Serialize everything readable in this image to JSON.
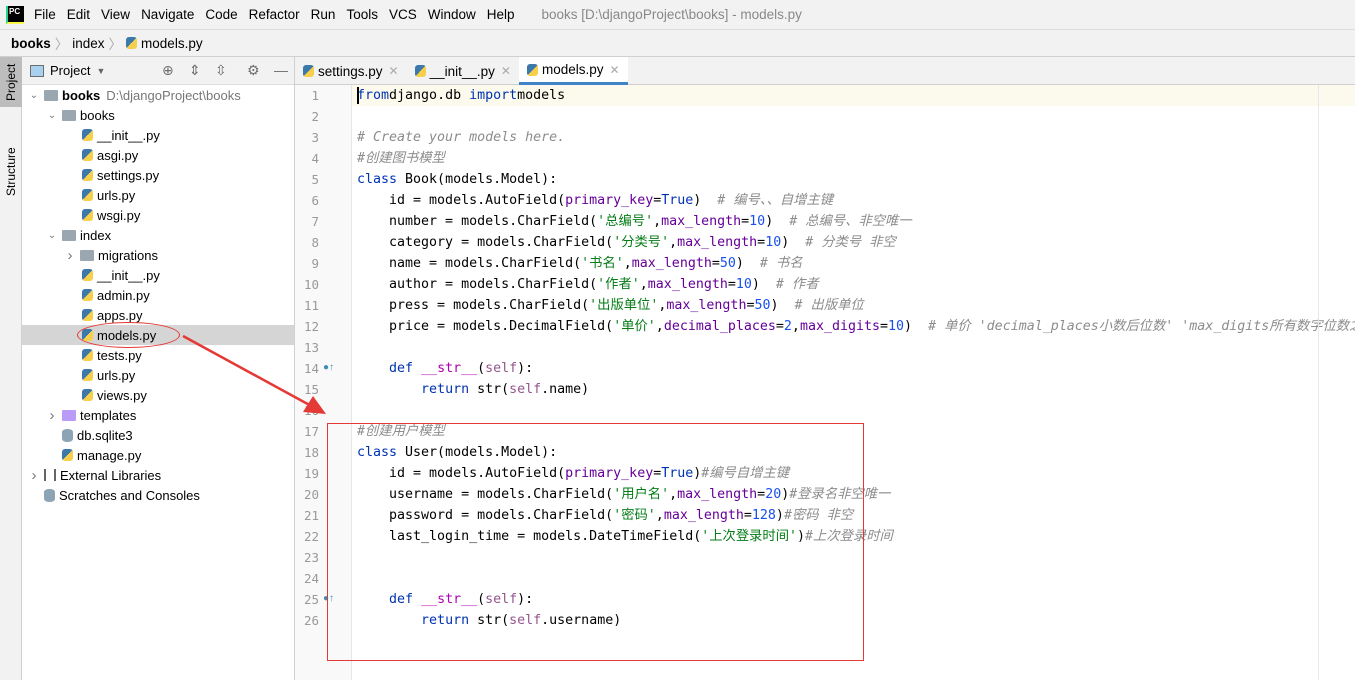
{
  "menubar": {
    "logo": "PC",
    "items": [
      "File",
      "Edit",
      "View",
      "Navigate",
      "Code",
      "Refactor",
      "Run",
      "Tools",
      "VCS",
      "Window",
      "Help"
    ],
    "window_title": "books [D:\\djangoProject\\books] - models.py"
  },
  "breadcrumb": [
    "books",
    "index",
    "models.py"
  ],
  "strip": {
    "project": "Project",
    "structure": "Structure"
  },
  "panel": {
    "title": "Project",
    "tree": [
      {
        "label": "books",
        "path": "D:\\djangoProject\\books",
        "type": "folder",
        "level": 0,
        "chevron": "down",
        "bold": true
      },
      {
        "label": "books",
        "type": "folder",
        "level": 1,
        "chevron": "down"
      },
      {
        "label": "__init__.py",
        "type": "py",
        "level": 2
      },
      {
        "label": "asgi.py",
        "type": "py",
        "level": 2
      },
      {
        "label": "settings.py",
        "type": "py",
        "level": 2
      },
      {
        "label": "urls.py",
        "type": "py",
        "level": 2
      },
      {
        "label": "wsgi.py",
        "type": "py",
        "level": 2
      },
      {
        "label": "index",
        "type": "folder",
        "level": 1,
        "chevron": "down"
      },
      {
        "label": "migrations",
        "type": "folder",
        "level": 2,
        "chevron": "right"
      },
      {
        "label": "__init__.py",
        "type": "py",
        "level": 2
      },
      {
        "label": "admin.py",
        "type": "py",
        "level": 2
      },
      {
        "label": "apps.py",
        "type": "py",
        "level": 2
      },
      {
        "label": "models.py",
        "type": "py",
        "level": 2,
        "selected": true
      },
      {
        "label": "tests.py",
        "type": "py",
        "level": 2
      },
      {
        "label": "urls.py",
        "type": "py",
        "level": 2
      },
      {
        "label": "views.py",
        "type": "py",
        "level": 2
      },
      {
        "label": "templates",
        "type": "tpl",
        "level": 1,
        "chevron": "right"
      },
      {
        "label": "db.sqlite3",
        "type": "db",
        "level": 1
      },
      {
        "label": "manage.py",
        "type": "py",
        "level": 1
      },
      {
        "label": "External Libraries",
        "type": "lib",
        "level": 0,
        "chevron": "right"
      },
      {
        "label": "Scratches and Consoles",
        "type": "scratch",
        "level": 0
      }
    ]
  },
  "tabs": [
    {
      "label": "settings.py"
    },
    {
      "label": "__init__.py"
    },
    {
      "label": "models.py",
      "active": true
    }
  ],
  "code": [
    [
      [
        "kw",
        "from"
      ],
      [
        "",
        "django.db "
      ],
      [
        "kw",
        "import"
      ],
      [
        "",
        "models"
      ]
    ],
    [],
    [
      [
        "cmt",
        "# Create your models here."
      ]
    ],
    [
      [
        "cmt",
        "#创建图书模型"
      ]
    ],
    [
      [
        "kw",
        "class"
      ],
      [
        "",
        " Book(models.Model):"
      ]
    ],
    [
      [
        "",
        "    id = models.AutoField("
      ],
      [
        "kwa",
        "primary_key"
      ],
      [
        "",
        "="
      ],
      [
        "kw",
        "True"
      ],
      [
        "",
        ")  "
      ],
      [
        "cmt",
        "# 编号、、自增主键"
      ]
    ],
    [
      [
        "",
        "    number = models.CharField("
      ],
      [
        "str",
        "'总编号'"
      ],
      [
        "",
        ","
      ],
      [
        "kwa",
        "max_length"
      ],
      [
        "",
        "="
      ],
      [
        "num",
        "10"
      ],
      [
        "",
        ")  "
      ],
      [
        "cmt",
        "# 总编号、非空唯一"
      ]
    ],
    [
      [
        "",
        "    category = models.CharField("
      ],
      [
        "str",
        "'分类号'"
      ],
      [
        "",
        ","
      ],
      [
        "kwa",
        "max_length"
      ],
      [
        "",
        "="
      ],
      [
        "num",
        "10"
      ],
      [
        "",
        ")  "
      ],
      [
        "cmt",
        "# 分类号 非空"
      ]
    ],
    [
      [
        "",
        "    name = models.CharField("
      ],
      [
        "str",
        "'书名'"
      ],
      [
        "",
        ","
      ],
      [
        "kwa",
        "max_length"
      ],
      [
        "",
        "="
      ],
      [
        "num",
        "50"
      ],
      [
        "",
        ")  "
      ],
      [
        "cmt",
        "# 书名"
      ]
    ],
    [
      [
        "",
        "    author = models.CharField("
      ],
      [
        "str",
        "'作者'"
      ],
      [
        "",
        ","
      ],
      [
        "kwa",
        "max_length"
      ],
      [
        "",
        "="
      ],
      [
        "num",
        "10"
      ],
      [
        "",
        ")  "
      ],
      [
        "cmt",
        "# 作者"
      ]
    ],
    [
      [
        "",
        "    press = models.CharField("
      ],
      [
        "str",
        "'出版单位'"
      ],
      [
        "",
        ","
      ],
      [
        "kwa",
        "max_length"
      ],
      [
        "",
        "="
      ],
      [
        "num",
        "50"
      ],
      [
        "",
        ")  "
      ],
      [
        "cmt",
        "# 出版单位"
      ]
    ],
    [
      [
        "",
        "    price = models.DecimalField("
      ],
      [
        "str",
        "'单价'"
      ],
      [
        "",
        ","
      ],
      [
        "kwa",
        "decimal_places"
      ],
      [
        "",
        "="
      ],
      [
        "num",
        "2"
      ],
      [
        "",
        ","
      ],
      [
        "kwa",
        "max_digits"
      ],
      [
        "",
        "="
      ],
      [
        "num",
        "10"
      ],
      [
        "",
        ")  "
      ],
      [
        "cmt",
        "# 单价 'decimal_places小数后位数' 'max_digits所有数字位数之"
      ]
    ],
    [],
    [
      [
        "",
        "    "
      ],
      [
        "kw",
        "def"
      ],
      [
        "",
        " "
      ],
      [
        "mag",
        "__str__"
      ],
      [
        "",
        "("
      ],
      [
        "self",
        "self"
      ],
      [
        "",
        "):"
      ]
    ],
    [
      [
        "",
        "        "
      ],
      [
        "kw",
        "return"
      ],
      [
        "",
        " str("
      ],
      [
        "self",
        "self"
      ],
      [
        "",
        ".name)"
      ]
    ],
    [],
    [
      [
        "cmt",
        "#创建用户模型"
      ]
    ],
    [
      [
        "kw",
        "class"
      ],
      [
        "",
        " User(models.Model):"
      ]
    ],
    [
      [
        "",
        "    id = models.AutoField("
      ],
      [
        "kwa",
        "primary_key"
      ],
      [
        "",
        "="
      ],
      [
        "kw",
        "True"
      ],
      [
        "",
        ")"
      ],
      [
        "cmt",
        "#编号自增主键"
      ]
    ],
    [
      [
        "",
        "    username = models.CharField("
      ],
      [
        "str",
        "'用户名'"
      ],
      [
        "",
        ","
      ],
      [
        "kwa",
        "max_length"
      ],
      [
        "",
        "="
      ],
      [
        "num",
        "20"
      ],
      [
        "",
        ")"
      ],
      [
        "cmt",
        "#登录名非空唯一"
      ]
    ],
    [
      [
        "",
        "    password = models.CharField("
      ],
      [
        "str",
        "'密码'"
      ],
      [
        "",
        ","
      ],
      [
        "kwa",
        "max_length"
      ],
      [
        "",
        "="
      ],
      [
        "num",
        "128"
      ],
      [
        "",
        ")"
      ],
      [
        "cmt",
        "#密码 非空"
      ]
    ],
    [
      [
        "",
        "    last_login_time = models.DateTimeField("
      ],
      [
        "str",
        "'上次登录时间'"
      ],
      [
        "",
        ")"
      ],
      [
        "cmt",
        "#上次登录时间"
      ]
    ],
    [],
    [],
    [
      [
        "",
        "    "
      ],
      [
        "kw",
        "def"
      ],
      [
        "",
        " "
      ],
      [
        "mag",
        "__str__"
      ],
      [
        "",
        "("
      ],
      [
        "self",
        "self"
      ],
      [
        "",
        "):"
      ]
    ],
    [
      [
        "",
        "        "
      ],
      [
        "kw",
        "return"
      ],
      [
        "",
        " str("
      ],
      [
        "self",
        "self"
      ],
      [
        "",
        ".username)"
      ]
    ]
  ],
  "colors": {
    "annotation": "#e53935",
    "accent": "#4083c9"
  }
}
